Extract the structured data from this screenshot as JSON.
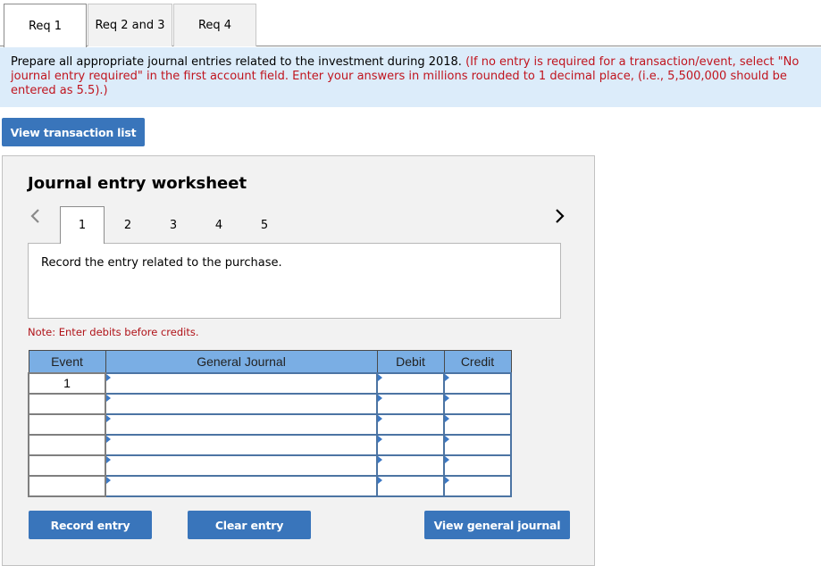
{
  "tabs": [
    {
      "label": "Req 1",
      "active": true
    },
    {
      "label": "Req 2 and 3",
      "active": false
    },
    {
      "label": "Req 4",
      "active": false
    }
  ],
  "instructions": {
    "main": "Prepare all appropriate journal entries related to the investment during 2018.",
    "note": "(If no entry is required for a transaction/event, select \"No journal entry required\" in the first account field. Enter your answers in millions rounded to 1 decimal place, (i.e., 5,500,000 should be entered as 5.5).)"
  },
  "buttons": {
    "view_transaction_list": "View transaction list",
    "record_entry": "Record entry",
    "clear_entry": "Clear entry",
    "view_general_journal": "View general journal"
  },
  "worksheet": {
    "title": "Journal entry worksheet",
    "steps": [
      "1",
      "2",
      "3",
      "4",
      "5"
    ],
    "active_step": "1",
    "description": "Record the entry related to the purchase.",
    "note": "Note: Enter debits before credits."
  },
  "table": {
    "headers": [
      "Event",
      "General Journal",
      "Debit",
      "Credit"
    ],
    "rows": [
      {
        "event": "1",
        "account": "",
        "debit": "",
        "credit": ""
      },
      {
        "event": "",
        "account": "",
        "debit": "",
        "credit": ""
      },
      {
        "event": "",
        "account": "",
        "debit": "",
        "credit": ""
      },
      {
        "event": "",
        "account": "",
        "debit": "",
        "credit": ""
      },
      {
        "event": "",
        "account": "",
        "debit": "",
        "credit": ""
      },
      {
        "event": "",
        "account": "",
        "debit": "",
        "credit": ""
      }
    ]
  },
  "colors": {
    "button_blue": "#3975bb",
    "header_blue": "#7aaee4",
    "instruction_bg": "#dcecfa",
    "note_red": "#c0141e"
  }
}
